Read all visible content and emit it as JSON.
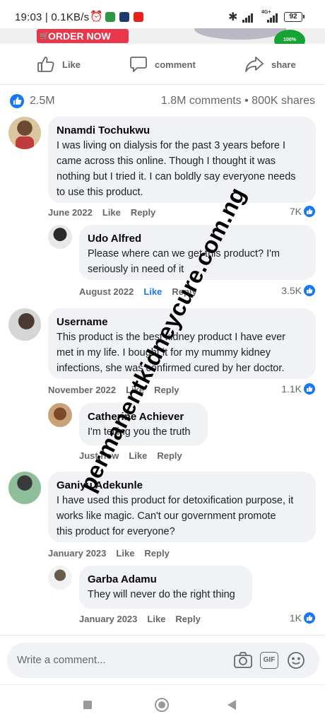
{
  "status_bar": {
    "time_speed": "19:03 | 0.1KB/s",
    "network": "4G+",
    "battery": "92"
  },
  "ad": {
    "order_label": "ORDER NOW",
    "badge": "100%"
  },
  "actions": {
    "like": "Like",
    "comment": "comment",
    "share": "share"
  },
  "post_stats": {
    "likes": "2.5M",
    "comments_shares": "1.8M comments • 800K shares"
  },
  "comments": [
    {
      "name": "Nnamdi Tochukwu",
      "lines": [
        "I was living on dialysis for the past 3 years before I",
        "came across this online. Though I thought it was",
        "nothing but I tried it. I can boldly say everyone needs",
        "to use this product."
      ],
      "date": "June 2022",
      "like": "Like",
      "reply": "Reply",
      "reactions": "7K"
    },
    {
      "name": "Udo Alfred",
      "lines": [
        "Please where can we get this product? I'm",
        "seriously in need of it"
      ],
      "date": "August 2022",
      "like": "Like",
      "reply": "Reply",
      "reactions": "3.5K"
    },
    {
      "name": "Username",
      "lines": [
        "This product is the best kidney product I have ever",
        "met in my life. I bought it for my mummy kidney",
        "infections, she was confirmed cured by her doctor."
      ],
      "date": "November 2022",
      "like": "Like",
      "reply": "Reply",
      "reactions": "1.1K"
    },
    {
      "name": "Catherine Achiever",
      "lines": [
        "I'm telling you the truth"
      ],
      "date": "Just now",
      "like": "Like",
      "reply": "Reply",
      "reactions": ""
    },
    {
      "name": "Ganiyu Adekunle",
      "lines": [
        "I have used this product for detoxification purpose, it",
        "works like magic. Can't our government promote",
        "this product for everyone?"
      ],
      "date": "January 2023",
      "like": "Like",
      "reply": "Reply",
      "reactions": ""
    },
    {
      "name": "Garba Adamu",
      "lines": [
        "They will never do the right thing"
      ],
      "date": "January 2023",
      "like": "Like",
      "reply": "Reply",
      "reactions": "1K"
    }
  ],
  "composer": {
    "placeholder": "Write a comment...",
    "gif_label": "GIF"
  },
  "watermark": "permanentkidneycure.com.ng",
  "colors": {
    "accent": "#1877f2",
    "order_button": "#e8374a",
    "bubble": "#f0f2f5"
  }
}
